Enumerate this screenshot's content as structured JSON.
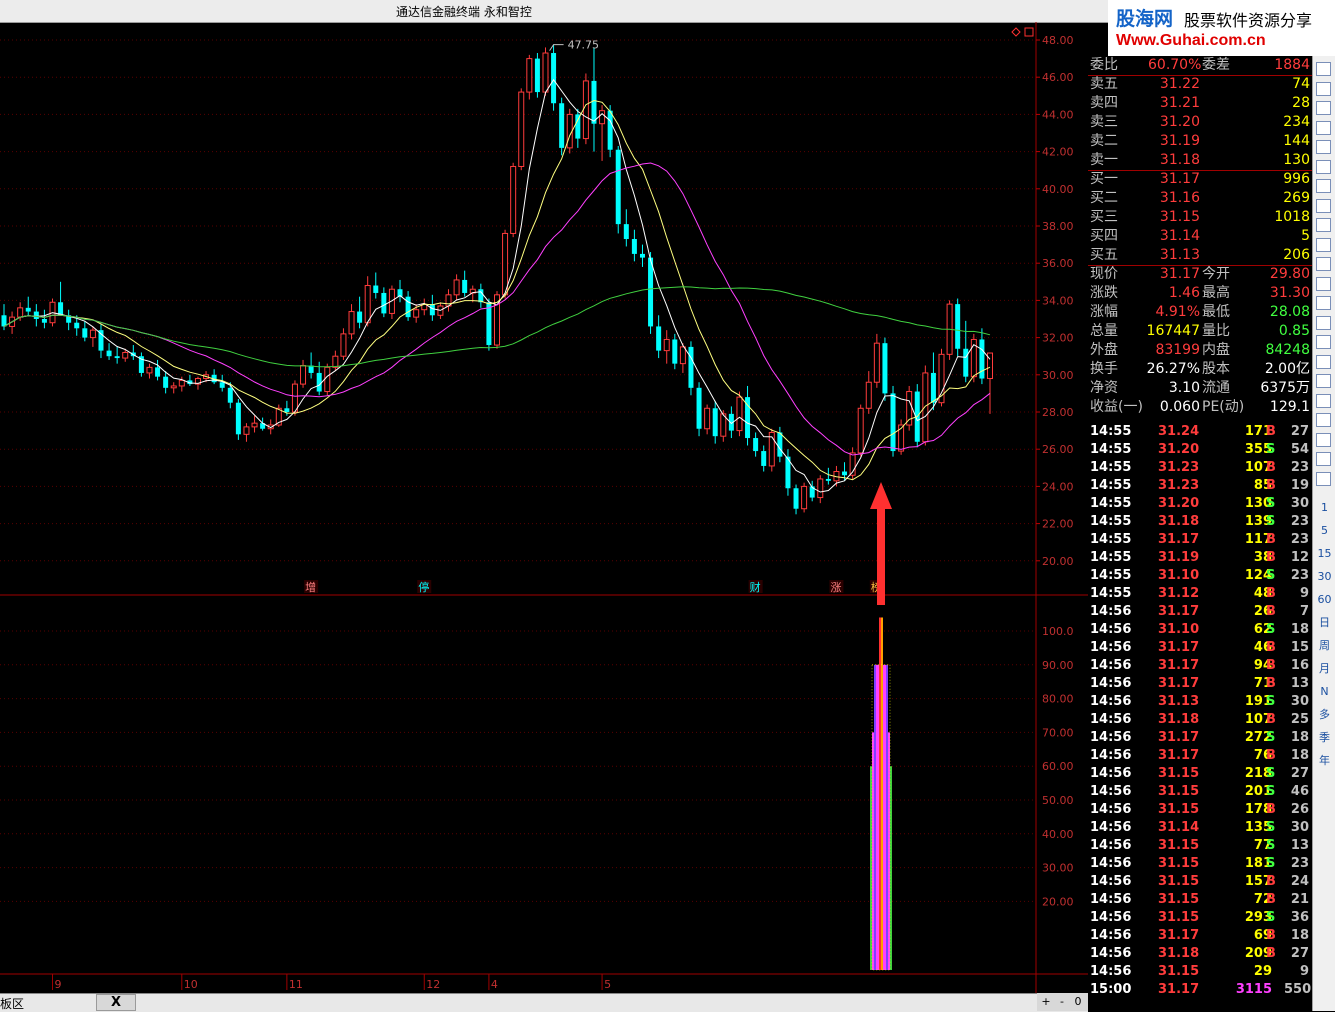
{
  "window": {
    "title": "通达信金融终端    永和智控"
  },
  "logo": {
    "brand": "股海网",
    "slogan": "股票软件资源分享",
    "url": "Www.Guhai.com.cn"
  },
  "colors": {
    "up": "#ff3c3c",
    "down": "#00ffff",
    "ma5": "#ffffff",
    "ma10": "#ffff80",
    "ma20": "#ff40ff",
    "ma60": "#40d040",
    "arrow": "#ff3030"
  },
  "price_axis": [
    "48.00",
    "46.00",
    "44.00",
    "42.00",
    "40.00",
    "38.00",
    "36.00",
    "34.00",
    "32.00",
    "30.00",
    "28.00",
    "26.00",
    "24.00",
    "22.00",
    "20.00"
  ],
  "indicator_axis": [
    "100.0",
    "90.00",
    "80.00",
    "70.00",
    "60.00",
    "50.00",
    "40.00",
    "30.00",
    "20.00"
  ],
  "x_axis_labels": [
    "9",
    "10",
    "11",
    "12",
    "4",
    "5"
  ],
  "peak_label": "47.75",
  "event_markers": [
    {
      "label": "增",
      "color": "#ff8080"
    },
    {
      "label": "停",
      "color": "#00ffff"
    },
    {
      "label": "财",
      "color": "#00ffff"
    },
    {
      "label": "涨",
      "color": "#ff8080"
    },
    {
      "label": "榜",
      "color": "#ffc040"
    }
  ],
  "chart_data": {
    "type": "candlestick",
    "ylim": [
      19,
      49
    ],
    "candles": [
      [
        33.2,
        33.8,
        32.4,
        32.6
      ],
      [
        32.6,
        33.4,
        32.2,
        33.1
      ],
      [
        33.1,
        33.9,
        32.9,
        33.6
      ],
      [
        33.6,
        34.2,
        33.2,
        33.4
      ],
      [
        33.4,
        33.8,
        32.6,
        33.0
      ],
      [
        33.0,
        33.5,
        32.5,
        32.8
      ],
      [
        32.8,
        34.1,
        32.6,
        33.9
      ],
      [
        33.9,
        35.0,
        33.5,
        33.2
      ],
      [
        33.2,
        33.5,
        32.4,
        32.8
      ],
      [
        32.8,
        33.2,
        32.1,
        32.5
      ],
      [
        32.5,
        32.9,
        31.8,
        32.0
      ],
      [
        32.0,
        32.6,
        31.5,
        32.4
      ],
      [
        32.4,
        32.7,
        30.9,
        31.3
      ],
      [
        31.3,
        31.7,
        30.8,
        31.0
      ],
      [
        31.0,
        31.5,
        30.6,
        30.9
      ],
      [
        30.9,
        31.4,
        30.7,
        31.2
      ],
      [
        31.2,
        31.6,
        30.8,
        31.0
      ],
      [
        31.0,
        31.2,
        29.9,
        30.1
      ],
      [
        30.1,
        30.6,
        29.8,
        30.4
      ],
      [
        30.4,
        30.8,
        29.7,
        29.9
      ],
      [
        29.9,
        30.2,
        29.0,
        29.3
      ],
      [
        29.3,
        29.6,
        29.0,
        29.4
      ],
      [
        29.4,
        29.9,
        29.1,
        29.7
      ],
      [
        29.7,
        30.0,
        29.4,
        29.5
      ],
      [
        29.5,
        29.9,
        29.2,
        29.8
      ],
      [
        29.8,
        30.2,
        29.6,
        30.0
      ],
      [
        30.0,
        30.3,
        29.5,
        29.6
      ],
      [
        29.6,
        30.0,
        29.1,
        29.3
      ],
      [
        29.3,
        29.6,
        28.2,
        28.5
      ],
      [
        28.5,
        28.7,
        26.5,
        26.8
      ],
      [
        26.8,
        27.4,
        26.4,
        27.2
      ],
      [
        27.2,
        27.8,
        26.9,
        27.4
      ],
      [
        27.4,
        27.7,
        27.0,
        27.1
      ],
      [
        27.1,
        27.6,
        26.8,
        27.3
      ],
      [
        27.3,
        28.4,
        27.2,
        28.2
      ],
      [
        28.2,
        28.6,
        27.8,
        28.0
      ],
      [
        28.0,
        29.7,
        27.8,
        29.5
      ],
      [
        29.5,
        30.8,
        29.3,
        30.5
      ],
      [
        30.5,
        31.2,
        29.8,
        30.1
      ],
      [
        30.1,
        30.7,
        28.9,
        29.1
      ],
      [
        29.1,
        30.6,
        28.9,
        30.4
      ],
      [
        30.4,
        31.3,
        30.2,
        31.0
      ],
      [
        31.0,
        32.5,
        30.8,
        32.2
      ],
      [
        32.2,
        33.8,
        31.9,
        33.4
      ],
      [
        33.4,
        34.2,
        32.5,
        32.8
      ],
      [
        32.8,
        35.3,
        32.6,
        34.8
      ],
      [
        34.8,
        35.5,
        34.1,
        34.4
      ],
      [
        34.4,
        34.7,
        33.1,
        33.3
      ],
      [
        33.3,
        34.8,
        33.0,
        34.6
      ],
      [
        34.6,
        35.1,
        33.9,
        34.2
      ],
      [
        34.2,
        34.5,
        32.9,
        33.1
      ],
      [
        33.1,
        33.8,
        32.8,
        33.5
      ],
      [
        33.5,
        34.1,
        33.2,
        33.8
      ],
      [
        33.8,
        34.3,
        32.9,
        33.2
      ],
      [
        33.2,
        33.9,
        33.0,
        33.7
      ],
      [
        33.7,
        34.6,
        33.4,
        34.3
      ],
      [
        34.3,
        35.4,
        34.0,
        35.1
      ],
      [
        35.1,
        35.6,
        34.2,
        34.4
      ],
      [
        34.4,
        34.8,
        33.9,
        34.6
      ],
      [
        34.6,
        34.9,
        33.6,
        33.9
      ],
      [
        33.9,
        34.1,
        31.3,
        31.6
      ],
      [
        31.6,
        34.5,
        31.4,
        34.3
      ],
      [
        34.3,
        37.8,
        34.1,
        37.6
      ],
      [
        37.6,
        41.4,
        37.4,
        41.2
      ],
      [
        41.2,
        45.4,
        41.0,
        45.2
      ],
      [
        45.2,
        47.2,
        44.8,
        47.0
      ],
      [
        47.0,
        47.3,
        44.9,
        45.2
      ],
      [
        45.2,
        47.6,
        45.0,
        47.3
      ],
      [
        47.3,
        47.75,
        44.2,
        44.6
      ],
      [
        44.6,
        44.9,
        41.8,
        42.2
      ],
      [
        42.2,
        44.3,
        41.9,
        44.0
      ],
      [
        44.0,
        44.3,
        42.2,
        42.7
      ],
      [
        42.7,
        46.2,
        42.4,
        45.8
      ],
      [
        45.8,
        47.6,
        42.0,
        43.5
      ],
      [
        43.5,
        44.5,
        41.5,
        44.2
      ],
      [
        44.2,
        44.5,
        41.7,
        42.1
      ],
      [
        42.1,
        42.3,
        37.6,
        38.1
      ],
      [
        38.1,
        38.9,
        36.9,
        37.3
      ],
      [
        37.3,
        37.8,
        36.1,
        36.5
      ],
      [
        36.5,
        37.0,
        35.8,
        36.3
      ],
      [
        36.3,
        36.6,
        32.2,
        32.6
      ],
      [
        32.6,
        33.2,
        30.9,
        31.3
      ],
      [
        31.3,
        32.4,
        30.6,
        31.9
      ],
      [
        31.9,
        32.2,
        30.3,
        30.6
      ],
      [
        30.6,
        31.7,
        30.1,
        31.5
      ],
      [
        31.5,
        31.8,
        28.9,
        29.3
      ],
      [
        29.3,
        29.6,
        26.7,
        27.1
      ],
      [
        27.1,
        28.4,
        26.8,
        28.2
      ],
      [
        28.2,
        28.6,
        26.3,
        26.7
      ],
      [
        26.7,
        28.1,
        26.4,
        27.9
      ],
      [
        27.9,
        28.3,
        26.6,
        27.0
      ],
      [
        27.0,
        29.1,
        26.7,
        28.8
      ],
      [
        28.8,
        29.4,
        26.2,
        26.6
      ],
      [
        26.6,
        26.9,
        25.6,
        25.9
      ],
      [
        25.9,
        26.2,
        24.8,
        25.1
      ],
      [
        25.1,
        27.1,
        24.8,
        26.9
      ],
      [
        26.9,
        27.2,
        25.3,
        25.6
      ],
      [
        25.6,
        26.0,
        23.5,
        23.9
      ],
      [
        23.9,
        24.1,
        22.5,
        22.8
      ],
      [
        22.8,
        24.2,
        22.6,
        24.0
      ],
      [
        24.0,
        24.3,
        23.2,
        23.4
      ],
      [
        23.4,
        24.6,
        23.1,
        24.4
      ],
      [
        24.4,
        25.0,
        24.1,
        24.3
      ],
      [
        24.3,
        25.1,
        24.0,
        24.8
      ],
      [
        24.8,
        25.3,
        24.3,
        24.6
      ],
      [
        24.6,
        26.1,
        24.4,
        25.8
      ],
      [
        25.8,
        28.4,
        25.6,
        28.2
      ],
      [
        28.2,
        30.2,
        27.9,
        29.6
      ],
      [
        29.6,
        32.2,
        29.3,
        31.7
      ],
      [
        31.7,
        32.0,
        28.6,
        29.0
      ],
      [
        29.0,
        29.4,
        25.6,
        25.9
      ],
      [
        25.9,
        27.6,
        25.7,
        27.3
      ],
      [
        27.3,
        29.4,
        27.0,
        29.1
      ],
      [
        29.1,
        29.5,
        26.1,
        26.4
      ],
      [
        26.4,
        30.5,
        26.2,
        30.1
      ],
      [
        30.1,
        31.2,
        28.1,
        28.5
      ],
      [
        28.5,
        31.4,
        28.3,
        31.1
      ],
      [
        31.1,
        34.0,
        30.8,
        33.8
      ],
      [
        33.8,
        34.1,
        31.0,
        31.4
      ],
      [
        31.4,
        32.9,
        29.6,
        29.9
      ],
      [
        29.9,
        32.2,
        29.6,
        31.9
      ],
      [
        31.9,
        32.5,
        29.5,
        29.8
      ],
      [
        29.8,
        31.2,
        27.9,
        31.17
      ]
    ]
  },
  "indicator_data": {
    "type": "bar",
    "peak_value": 104,
    "base_value": 60
  },
  "quote": {
    "header": {
      "label1": "委比",
      "value1": "60.70%",
      "label2": "委差",
      "value2": "1884"
    },
    "asks": [
      {
        "label": "卖五",
        "price": "31.22",
        "vol": "74"
      },
      {
        "label": "卖四",
        "price": "31.21",
        "vol": "28"
      },
      {
        "label": "卖三",
        "price": "31.20",
        "vol": "234"
      },
      {
        "label": "卖二",
        "price": "31.19",
        "vol": "144"
      },
      {
        "label": "卖一",
        "price": "31.18",
        "vol": "130"
      }
    ],
    "bids": [
      {
        "label": "买一",
        "price": "31.17",
        "vol": "996"
      },
      {
        "label": "买二",
        "price": "31.16",
        "vol": "269"
      },
      {
        "label": "买三",
        "price": "31.15",
        "vol": "1018"
      },
      {
        "label": "买四",
        "price": "31.14",
        "vol": "5"
      },
      {
        "label": "买五",
        "price": "31.13",
        "vol": "206"
      }
    ],
    "stats": [
      {
        "l1": "现价",
        "v1": "31.17",
        "c1": "#ff3c3c",
        "l2": "今开",
        "v2": "29.80",
        "c2": "#ff3c3c"
      },
      {
        "l1": "涨跌",
        "v1": "1.46",
        "c1": "#ff3c3c",
        "l2": "最高",
        "v2": "31.30",
        "c2": "#ff3c3c"
      },
      {
        "l1": "涨幅",
        "v1": "4.91%",
        "c1": "#ff3c3c",
        "l2": "最低",
        "v2": "28.08",
        "c2": "#40ff40"
      },
      {
        "l1": "总量",
        "v1": "167447",
        "c1": "#ffff00",
        "l2": "量比",
        "v2": "0.85",
        "c2": "#40ff40"
      },
      {
        "l1": "外盘",
        "v1": "83199",
        "c1": "#ff3c3c",
        "l2": "内盘",
        "v2": "84248",
        "c2": "#40ff40"
      },
      {
        "l1": "换手",
        "v1": "26.27%",
        "c1": "#ffffff",
        "l2": "股本",
        "v2": "2.00亿",
        "c2": "#ffffff"
      },
      {
        "l1": "净资",
        "v1": "3.10",
        "c1": "#ffffff",
        "l2": "流通",
        "v2": "6375万",
        "c2": "#ffffff"
      },
      {
        "l1": "收益(一)",
        "v1": "0.060",
        "c1": "#ffffff",
        "l2": "PE(动)",
        "v2": "129.1",
        "c2": "#ffffff"
      }
    ]
  },
  "ticks": [
    {
      "t": "14:55",
      "p": "31.24",
      "v": "171",
      "d": "B",
      "n": "27"
    },
    {
      "t": "14:55",
      "p": "31.20",
      "v": "355",
      "d": "S",
      "n": "54"
    },
    {
      "t": "14:55",
      "p": "31.23",
      "v": "107",
      "d": "B",
      "n": "23"
    },
    {
      "t": "14:55",
      "p": "31.23",
      "v": "85",
      "d": "B",
      "n": "19"
    },
    {
      "t": "14:55",
      "p": "31.20",
      "v": "130",
      "d": "S",
      "n": "30"
    },
    {
      "t": "14:55",
      "p": "31.18",
      "v": "139",
      "d": "S",
      "n": "23"
    },
    {
      "t": "14:55",
      "p": "31.17",
      "v": "117",
      "d": "B",
      "n": "23"
    },
    {
      "t": "14:55",
      "p": "31.19",
      "v": "38",
      "d": "B",
      "n": "12"
    },
    {
      "t": "14:55",
      "p": "31.10",
      "v": "124",
      "d": "S",
      "n": "23"
    },
    {
      "t": "14:55",
      "p": "31.12",
      "v": "48",
      "d": "B",
      "n": "9"
    },
    {
      "t": "14:56",
      "p": "31.17",
      "v": "26",
      "d": "B",
      "n": "7"
    },
    {
      "t": "14:56",
      "p": "31.10",
      "v": "62",
      "d": "S",
      "n": "18"
    },
    {
      "t": "14:56",
      "p": "31.17",
      "v": "46",
      "d": "B",
      "n": "15"
    },
    {
      "t": "14:56",
      "p": "31.17",
      "v": "94",
      "d": "B",
      "n": "16"
    },
    {
      "t": "14:56",
      "p": "31.17",
      "v": "71",
      "d": "B",
      "n": "13"
    },
    {
      "t": "14:56",
      "p": "31.13",
      "v": "191",
      "d": "S",
      "n": "30"
    },
    {
      "t": "14:56",
      "p": "31.18",
      "v": "107",
      "d": "B",
      "n": "25"
    },
    {
      "t": "14:56",
      "p": "31.17",
      "v": "272",
      "d": "S",
      "n": "18"
    },
    {
      "t": "14:56",
      "p": "31.17",
      "v": "76",
      "d": "B",
      "n": "18"
    },
    {
      "t": "14:56",
      "p": "31.15",
      "v": "218",
      "d": "S",
      "n": "27"
    },
    {
      "t": "14:56",
      "p": "31.15",
      "v": "201",
      "d": "S",
      "n": "46"
    },
    {
      "t": "14:56",
      "p": "31.15",
      "v": "178",
      "d": "B",
      "n": "26"
    },
    {
      "t": "14:56",
      "p": "31.14",
      "v": "135",
      "d": "S",
      "n": "30"
    },
    {
      "t": "14:56",
      "p": "31.15",
      "v": "77",
      "d": "S",
      "n": "13"
    },
    {
      "t": "14:56",
      "p": "31.15",
      "v": "181",
      "d": "S",
      "n": "23"
    },
    {
      "t": "14:56",
      "p": "31.15",
      "v": "157",
      "d": "B",
      "n": "24"
    },
    {
      "t": "14:56",
      "p": "31.15",
      "v": "72",
      "d": "B",
      "n": "21"
    },
    {
      "t": "14:56",
      "p": "31.15",
      "v": "293",
      "d": "S",
      "n": "36"
    },
    {
      "t": "14:56",
      "p": "31.17",
      "v": "69",
      "d": "B",
      "n": "18"
    },
    {
      "t": "14:56",
      "p": "31.18",
      "v": "209",
      "d": "B",
      "n": "27"
    },
    {
      "t": "14:56",
      "p": "31.15",
      "v": "29",
      "d": "",
      "n": "9"
    },
    {
      "t": "15:00",
      "p": "31.17",
      "v": "3115",
      "d": "",
      "n": "550"
    }
  ],
  "toolbar_labels": [
    "1",
    "5",
    "15",
    "30",
    "60",
    "日",
    "周",
    "月",
    "N",
    "多",
    "季",
    "年"
  ],
  "status": {
    "left_text": "板区",
    "close": "X"
  },
  "zoom": {
    "plus": "+",
    "minus": "-",
    "zero": "0"
  }
}
